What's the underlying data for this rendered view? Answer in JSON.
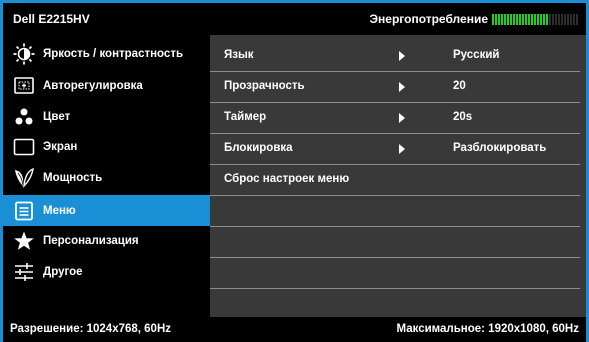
{
  "header": {
    "model": "Dell E2215HV",
    "energy_label": "Энергопотребление",
    "energy_level": 0.65
  },
  "sidebar": {
    "items": [
      {
        "label": "Яркость / контрастность",
        "icon": "brightness-contrast-icon",
        "active": false
      },
      {
        "label": "Авторегулировка",
        "icon": "auto-adjust-icon",
        "active": false
      },
      {
        "label": "Цвет",
        "icon": "color-icon",
        "active": false
      },
      {
        "label": "Экран",
        "icon": "display-icon",
        "active": false
      },
      {
        "label": "Мощность",
        "icon": "power-leaf-icon",
        "active": false
      },
      {
        "label": "Меню",
        "icon": "menu-icon",
        "active": true
      },
      {
        "label": "Персонализация",
        "icon": "star-icon",
        "active": false
      },
      {
        "label": "Другое",
        "icon": "sliders-icon",
        "active": false
      }
    ]
  },
  "main": {
    "rows": [
      {
        "name": "Язык",
        "has_arrow": true,
        "value": "Русский"
      },
      {
        "name": "Прозрачность",
        "has_arrow": true,
        "value": "20"
      },
      {
        "name": "Таймер",
        "has_arrow": true,
        "value": "20s"
      },
      {
        "name": "Блокировка",
        "has_arrow": true,
        "value": "Разблокировать"
      },
      {
        "name": "Сброс настроек меню",
        "has_arrow": false,
        "value": ""
      },
      {
        "name": "",
        "has_arrow": false,
        "value": ""
      },
      {
        "name": "",
        "has_arrow": false,
        "value": ""
      },
      {
        "name": "",
        "has_arrow": false,
        "value": ""
      }
    ]
  },
  "footer": {
    "resolution": "Разрешение: 1024x768, 60Hz",
    "max_resolution": "Максимальное: 1920x1080, 60Hz"
  },
  "colors": {
    "accent": "#1a8fd6",
    "energy_on": "#19d419",
    "content_bg": "#393939"
  }
}
